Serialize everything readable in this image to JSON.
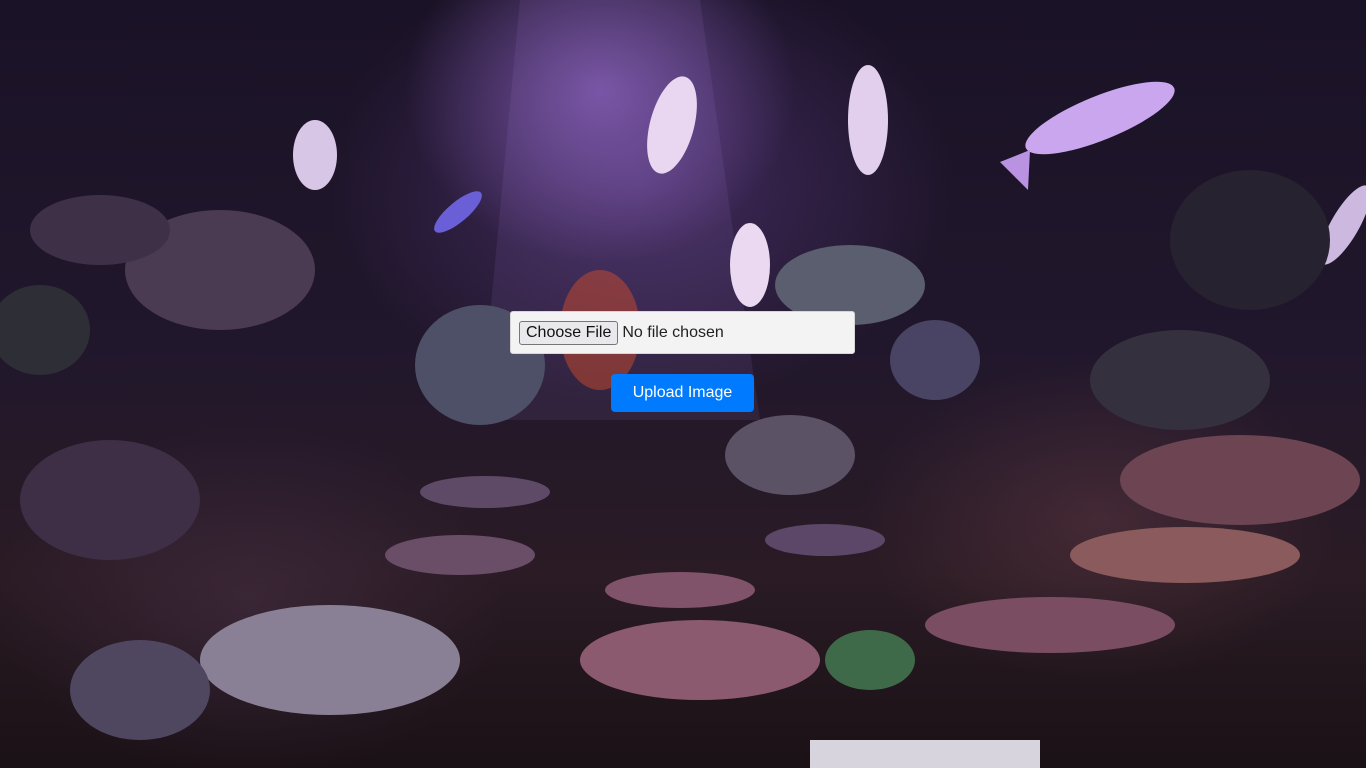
{
  "background": {
    "description_icon": "aquarium-background-image",
    "colors": {
      "light": "#b98be6",
      "deep": "#1a1226"
    }
  },
  "upload_form": {
    "file_input": {
      "button_label": "Choose File",
      "status_text": "No file chosen"
    },
    "submit_label": "Upload Image",
    "submit_color": "#007bff"
  }
}
